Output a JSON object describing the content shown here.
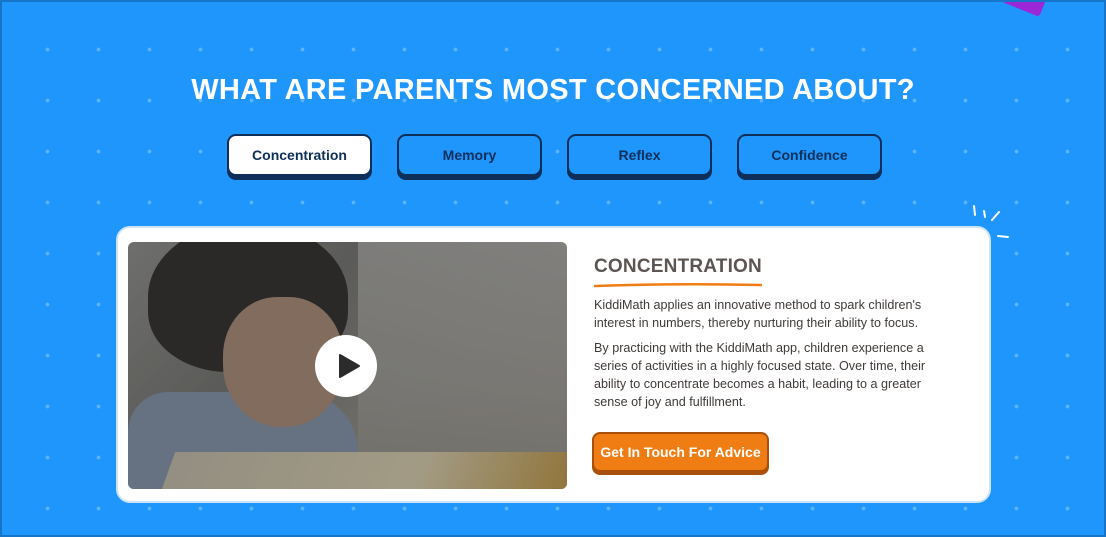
{
  "colors": {
    "background": "#1e96fc",
    "tab_border": "#0d2f5a",
    "cta": "#f07d14",
    "heading_underline": "#f07d14",
    "deco_corner": "#9c27d6"
  },
  "section": {
    "heading": "WHAT ARE PARENTS MOST CONCERNED ABOUT?"
  },
  "tabs": [
    {
      "label": "Concentration",
      "active": true
    },
    {
      "label": "Memory",
      "active": false
    },
    {
      "label": "Reflex",
      "active": false
    },
    {
      "label": "Confidence",
      "active": false
    }
  ],
  "card": {
    "video": {
      "play_icon": "play-icon"
    },
    "title": "CONCENTRATION",
    "paragraphs": [
      "KiddiMath applies an innovative method to spark children's interest in numbers, thereby nurturing their ability to focus.",
      "By practicing with the KiddiMath app, children experience a series of activities in a highly focused state. Over time, their ability to concentrate becomes a habit, leading to a greater sense of joy and fulfillment."
    ],
    "cta_label": "Get In Touch For Advice"
  }
}
